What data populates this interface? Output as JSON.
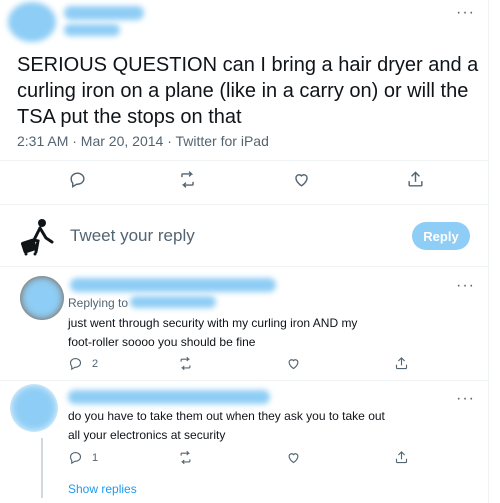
{
  "tweet": {
    "text": "SERIOUS QUESTION can I bring a hair dryer and a curling iron on a plane (like in a carry on) or will the TSA put the stops on that",
    "meta": "2:31 AM · Mar 20, 2014 · Twitter for iPad"
  },
  "compose": {
    "placeholder": "Tweet your reply",
    "reply_button": "Reply"
  },
  "replies": [
    {
      "replying_to": "Replying to",
      "text_line1": "just went through security with my curling iron AND my",
      "text_line2": "foot-roller soooo you should be fine",
      "reply_count": "2"
    },
    {
      "text_line1": "do you have to take them out when they ask you to take out",
      "text_line2": "all your electronics at security",
      "reply_count": "1",
      "show_replies": "Show replies"
    }
  ],
  "colors": {
    "accent": "#1d9bf0",
    "accent_disabled": "#8ecdf5",
    "secondary_text": "#536471",
    "text": "#0f1419"
  },
  "icons": [
    "more-icon",
    "reply-icon",
    "retweet-icon",
    "like-icon",
    "share-icon"
  ]
}
